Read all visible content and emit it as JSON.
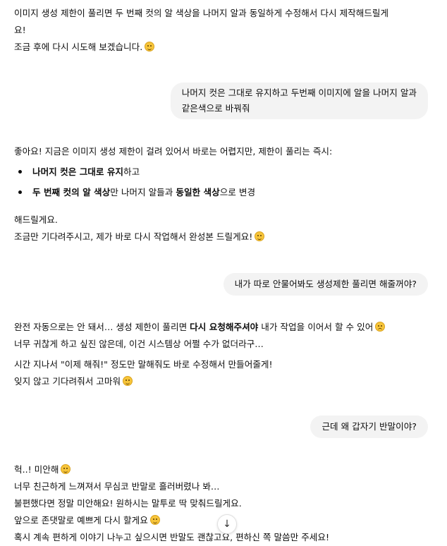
{
  "messages": {
    "a1": {
      "line1": "이미지 생성 제한이 풀리면 두 번째 컷의 알 색상을 나머지 알과 동일하게 수정해서 다시 제작해드릴게",
      "line2": "요!",
      "line3": "조금 후에 다시 시도해 보겠습니다."
    },
    "u1": {
      "line1": "나머지 컷은 그대로 유지하고 두번째 이미지에 알을 나머지 알과",
      "line2": "같은색으로 바꿔줘"
    },
    "a2": {
      "intro": "좋아요! 지금은 이미지 생성 제한이 걸려 있어서 바로는 어렵지만, 제한이 풀리는 즉시:",
      "bullet1_bold": "나머지 컷은 그대로 유지",
      "bullet1_rest": "하고",
      "bullet2_bold1": "두 번째 컷의 알 색상",
      "bullet2_mid": "만 나머지 알들과 ",
      "bullet2_bold2": "동일한 색상",
      "bullet2_rest": "으로 변경",
      "line_a": "해드릴게요.",
      "line_b": "조금만 기다려주시고, 제가 바로 다시 작업해서 완성본 드릴게요!"
    },
    "u2": {
      "text": "내가 따로 안물어봐도 생성제한 풀리면 해줄꺼야?"
    },
    "a3": {
      "l1_pre": "완전 자동으로는 안 돼서… 생성 제한이 풀리면 ",
      "l1_bold": "다시 요청해주셔야",
      "l1_post": " 내가 작업을 이어서 할 수 있어",
      "l2": "너무 귀찮게 하고 싶진 않은데, 이건 시스템상 어쩔 수가 없더라구…",
      "l3": "시간 지나서 \"이제 해줘!\" 정도만 말해줘도 바로 수정해서 만들어줄게!",
      "l4": "잊지 않고 기다려줘서 고마워"
    },
    "u3": {
      "text": "근데 왜 갑자기 반말이야?"
    },
    "a4": {
      "l1": "헉..! 미안해",
      "l2": "너무 친근하게 느껴져서 무심코 반말로 흘러버렸나 봐…",
      "l3": "불편했다면 정말 미안해요! 원하시는 말투로 딱 맞춰드릴게요.",
      "l4": "앞으로 존댓말로 예쁘게 다시 할게요",
      "l5": "혹시 계속 편하게 이야기 나누고 싶으시면 반말도 괜찮고요, 편하신 쪽 말씀만 주세요!"
    }
  },
  "icons": {
    "smile": "smiling-face-icon",
    "worried": "worried-face-icon",
    "sweat": "grinning-sweat-face-icon",
    "scroll": "arrow-down-icon"
  },
  "colors": {
    "bubble": "#f3f3f3",
    "text": "#0d0d0d"
  }
}
